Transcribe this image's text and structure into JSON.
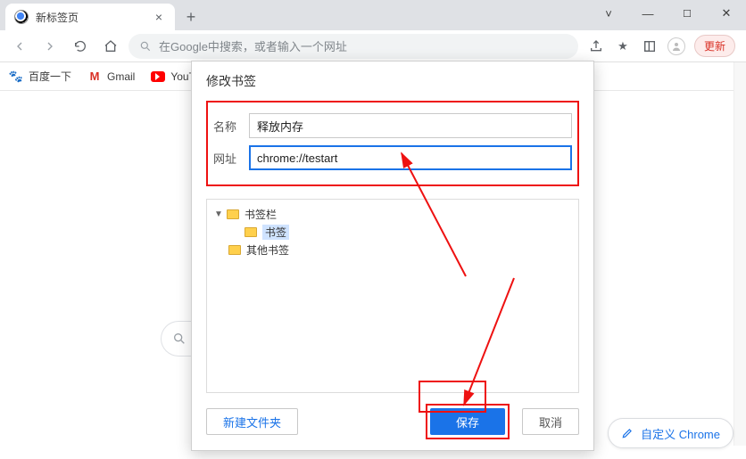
{
  "window": {
    "tab_title": "新标签页"
  },
  "toolbar": {
    "omnibox_placeholder": "在Google中搜索，或者输入一个网址",
    "update_label": "更新"
  },
  "bookmarks_bar": {
    "items": [
      {
        "label": "百度一下"
      },
      {
        "label": "Gmail"
      },
      {
        "label": "YouTu"
      }
    ]
  },
  "dialog": {
    "title": "修改书签",
    "name_label": "名称",
    "name_value": "释放内存",
    "url_label": "网址",
    "url_value": "chrome://testart",
    "tree": {
      "root": "书签栏",
      "selected": "书签",
      "other": "其他书签"
    },
    "new_folder_label": "新建文件夹",
    "save_label": "保存",
    "cancel_label": "取消"
  },
  "customize_label": "自定义 Chrome"
}
